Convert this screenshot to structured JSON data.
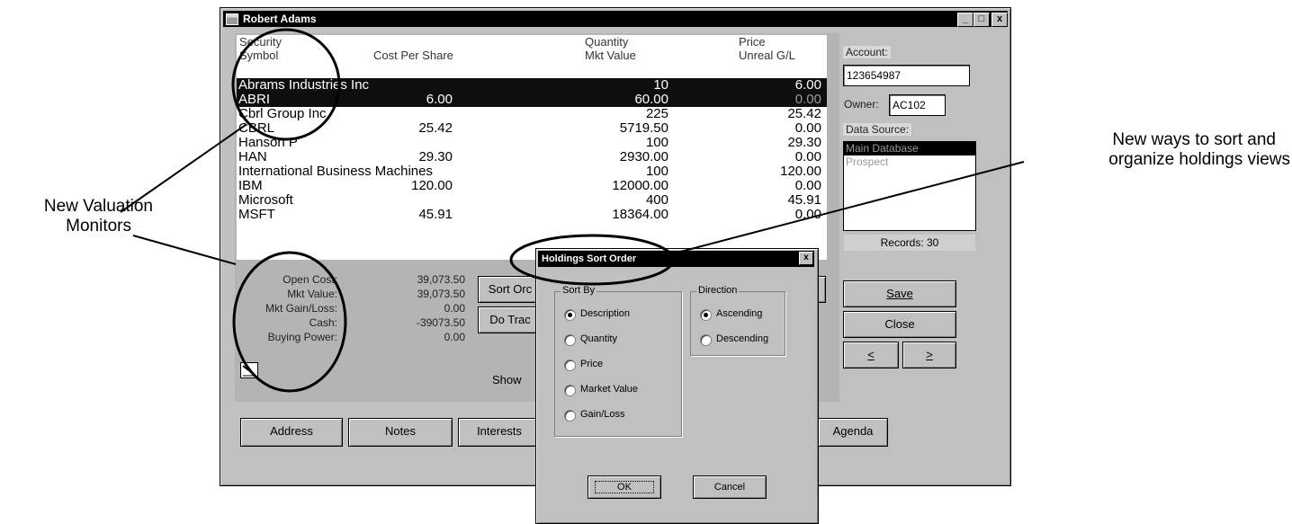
{
  "window": {
    "title": "Robert Adams",
    "controls": {
      "minimize": "_",
      "maximize": "□",
      "close": "x"
    }
  },
  "holdings": {
    "headers": {
      "col1_line1": "Security",
      "col1_line2": "Symbol",
      "col2": "Cost Per Share",
      "col3_line1": "Quantity",
      "col3_line2": "Mkt Value",
      "col4_line1": "Price",
      "col4_line2": "Unreal G/L"
    },
    "rows": [
      {
        "name": "Abrams Industries Inc",
        "symbol": "ABRI",
        "cost": "6.00",
        "quantity": "10",
        "mkt_value": "60.00",
        "price": "6.00",
        "unreal": "0.00",
        "selected": true
      },
      {
        "name": "Cbrl Group Inc",
        "symbol": "CBRL",
        "cost": "25.42",
        "quantity": "225",
        "mkt_value": "5719.50",
        "price": "25.42",
        "unreal": "0.00",
        "selected": false
      },
      {
        "name": "Hanson P",
        "symbol": "HAN",
        "cost": "29.30",
        "quantity": "100",
        "mkt_value": "2930.00",
        "price": "29.30",
        "unreal": "0.00",
        "selected": false
      },
      {
        "name": "International Business Machines",
        "symbol": "IBM",
        "cost": "120.00",
        "quantity": "100",
        "mkt_value": "12000.00",
        "price": "120.00",
        "unreal": "0.00",
        "selected": false
      },
      {
        "name": "Microsoft",
        "symbol": "MSFT",
        "cost": "45.91",
        "quantity": "400",
        "mkt_value": "18364.00",
        "price": "45.91",
        "unreal": "0.00",
        "selected": false
      }
    ]
  },
  "summary": [
    {
      "label": "Open Cost:",
      "value": "39,073.50"
    },
    {
      "label": "Mkt Value:",
      "value": "39,073.50"
    },
    {
      "label": "Mkt Gain/Loss:",
      "value": "0.00"
    },
    {
      "label": "Cash:",
      "value": "-39073.50"
    },
    {
      "label": "Buying Power:",
      "value": "0.00"
    }
  ],
  "mid_buttons": {
    "sort_order": "Sort Orc",
    "do_trade": "Do Trac"
  },
  "show_label": "Show",
  "right_panel": {
    "account_label": "Account:",
    "account_value": "123654987",
    "owner_label": "Owner:",
    "owner_value": "AC102",
    "data_source_label": "Data Source:",
    "data_sources": [
      "Main Database",
      "Prospect"
    ],
    "records": "Records: 30",
    "save": "Save",
    "close": "Close",
    "prev": "<",
    "next": ">"
  },
  "bottom_tabs": {
    "address": "Address",
    "notes": "Notes",
    "interests": "Interests",
    "agenda": "Agenda"
  },
  "dialog": {
    "title": "Holdings Sort Order",
    "close": "x",
    "sort_by_label": "Sort By",
    "sort_options": [
      "Description",
      "Quantity",
      "Price",
      "Market Value",
      "Gain/Loss"
    ],
    "sort_selected": "Description",
    "direction_label": "Direction",
    "direction_options": [
      "Ascending",
      "Descending"
    ],
    "direction_selected": "Ascending",
    "ok": "OK",
    "cancel": "Cancel"
  },
  "callouts": {
    "left_line1": "New Valuation",
    "left_line2": "Monitors",
    "right_line1": "New ways to sort and",
    "right_line2": "organize holdings views"
  }
}
